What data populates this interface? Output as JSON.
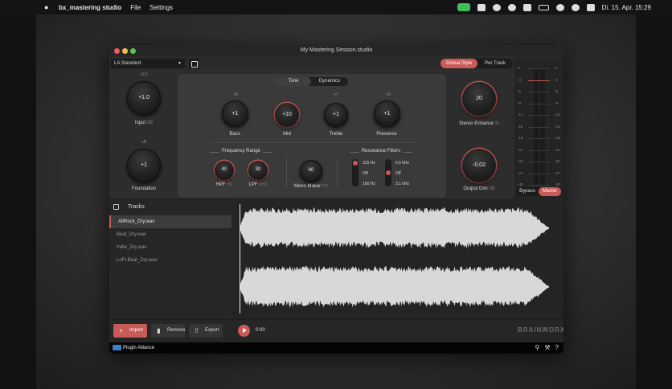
{
  "menubar": {
    "app_name": "bx_mastering studio",
    "menu_file": "File",
    "menu_settings": "Settings",
    "datetime": "Di. 15. Apr.  15:29"
  },
  "window": {
    "title": "My Mastering Session.studio"
  },
  "toolbar": {
    "preset": "LA Standard",
    "style_global": "Global Style",
    "style_per_track": "Per Track"
  },
  "tabs": {
    "tone": "Tone",
    "dynamics": "Dynamics"
  },
  "knobs": {
    "input": {
      "value": "+1.0",
      "label": "Input",
      "unit": "dB",
      "top": "+2.1"
    },
    "foundation": {
      "value": "+1",
      "label": "Foundation",
      "top": "+8"
    },
    "bass": {
      "value": "+1",
      "label": "Bass",
      "top": "+8"
    },
    "mid": {
      "value": "+10",
      "label": "Mid"
    },
    "treble": {
      "value": "+1",
      "label": "Treble",
      "top": "+7"
    },
    "presence": {
      "value": "+1",
      "label": "Presence",
      "top": "+9"
    },
    "hpf": {
      "value": "40",
      "label": "HPF",
      "unit": "Hz"
    },
    "lpf": {
      "value": "30",
      "label": "LPF",
      "unit": "kHz"
    },
    "mono_maker": {
      "value": "60",
      "label": "Mono Maker",
      "unit": "Hz"
    },
    "stereo_enhance": {
      "value": "20",
      "label": "Stereo Enhance",
      "unit": "%"
    },
    "output_dim": {
      "value": "-0.02",
      "label": "Output Dim",
      "unit": "dB"
    }
  },
  "sections": {
    "frequency_range": "Frequency Range",
    "resonance_filters": "Resonance Filters"
  },
  "resonance": {
    "left_top": "315 Hz",
    "left_mid": "Off",
    "left_bottom": "160 Hz",
    "right_top": "6.6 kHz",
    "right_mid": "Off",
    "right_bottom": "3.1 kHz"
  },
  "meter": {
    "ticks_left": [
      "0",
      "-3",
      "-6",
      "-9",
      "-12",
      "-15",
      "-18",
      "-21",
      "-24",
      "-27",
      "-30"
    ],
    "ticks_right": [
      "0",
      "-3",
      "-6",
      "-9",
      "-12",
      "-15",
      "-18",
      "-21",
      "-24",
      "-27",
      "-30"
    ],
    "bypass": "Bypass",
    "master": "Master"
  },
  "tracks": {
    "title": "Tracks",
    "items": [
      "AltRock_Dry.wav",
      "Beat_Dry.wav",
      "Indie_Dry.wav",
      "LoFi-Beat_Dry.wav"
    ]
  },
  "footer": {
    "import": "Import",
    "remove": "Remove",
    "export": "Export",
    "time": "0:00",
    "brand": "BRAINWORX"
  },
  "bottombar": {
    "plugin_alliance": "Plugin Alliance",
    "help": "?"
  },
  "colors": {
    "accent": "#c85a58",
    "panel": "#3a3a3a",
    "background": "#2b2b2b"
  }
}
